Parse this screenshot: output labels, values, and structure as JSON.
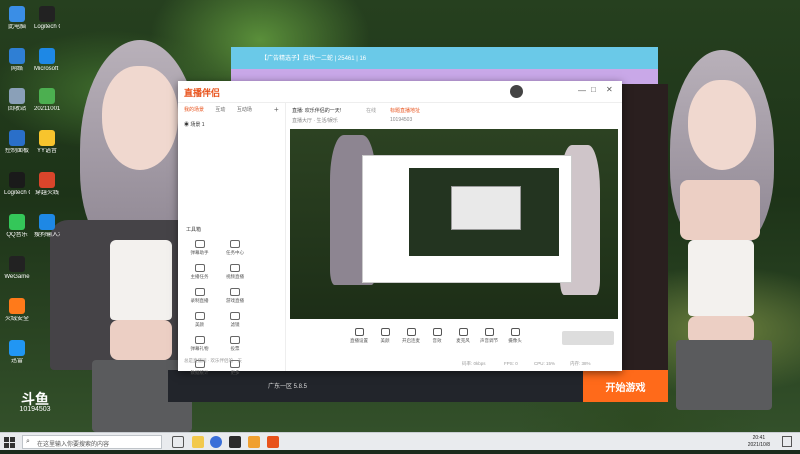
{
  "desktop_icons": [
    {
      "label": "此电脑",
      "color": "#3a8ee6"
    },
    {
      "label": "Logitech G HUB",
      "color": "#222222"
    },
    {
      "label": "网络",
      "color": "#2f7fd4"
    },
    {
      "label": "Microsoft Edge",
      "color": "#1e88e5"
    },
    {
      "label": "回收站",
      "color": "#8aa0b8"
    },
    {
      "label": "20211001...",
      "color": "#4caf50"
    },
    {
      "label": "控制面板",
      "color": "#2a6fc9"
    },
    {
      "label": "YY语音",
      "color": "#f7c42d"
    },
    {
      "label": "Logitech G HUB",
      "color": "#1a1a1a"
    },
    {
      "label": "穿越火线",
      "color": "#d9452b"
    },
    {
      "label": "QQ音乐",
      "color": "#34c759"
    },
    {
      "label": "搜狗输入法",
      "color": "#1e88e5"
    },
    {
      "label": "WeGame",
      "color": "#222222"
    },
    {
      "label": "火绒安全",
      "color": "#ff7a1a"
    },
    {
      "label": "迅雷",
      "color": "#2196f3"
    }
  ],
  "back_window": {
    "title": "【广告精选子】白状一二蛇 | 25461 | 16"
  },
  "main_window": {
    "logo": "直播伴侣",
    "sidebar_tabs": [
      "我的场景",
      "互动",
      "互动场"
    ],
    "scene_item": "场景 1",
    "tools_label": "工具箱",
    "tools": [
      "弹幕助手",
      "任务中心",
      "主播任务",
      "视频直播",
      "录制直播",
      "游戏直播",
      "美颜",
      "滤镜",
      "弹幕礼物",
      "投票",
      "数据统计",
      "更多"
    ],
    "header_title": "直播: 欢乐伴侣的一天!",
    "header_tag": "在线",
    "header_link": "标题直播地址",
    "header_sub": "直播大厅 · 生活/娱乐",
    "room_id": "10194503",
    "controls": [
      "直播设置",
      "美颜",
      "开启连麦",
      "音效",
      "麦克风",
      "声音调节",
      "摄像头"
    ],
    "status": [
      "码率: 0kbps",
      "FPS: 0",
      "CPU: 15%",
      "内存: 38%"
    ],
    "bottom_text": "总是直播间 · 欢乐伴侣的一天"
  },
  "obs_bar": {
    "version": "广东一区 5.8.5",
    "start_label": "开始游戏"
  },
  "watermark": {
    "channel": "10194503"
  },
  "taskbar": {
    "search_placeholder": "在这里输入你要搜索的内容",
    "time": "20:41",
    "date": "2021/10/8"
  }
}
